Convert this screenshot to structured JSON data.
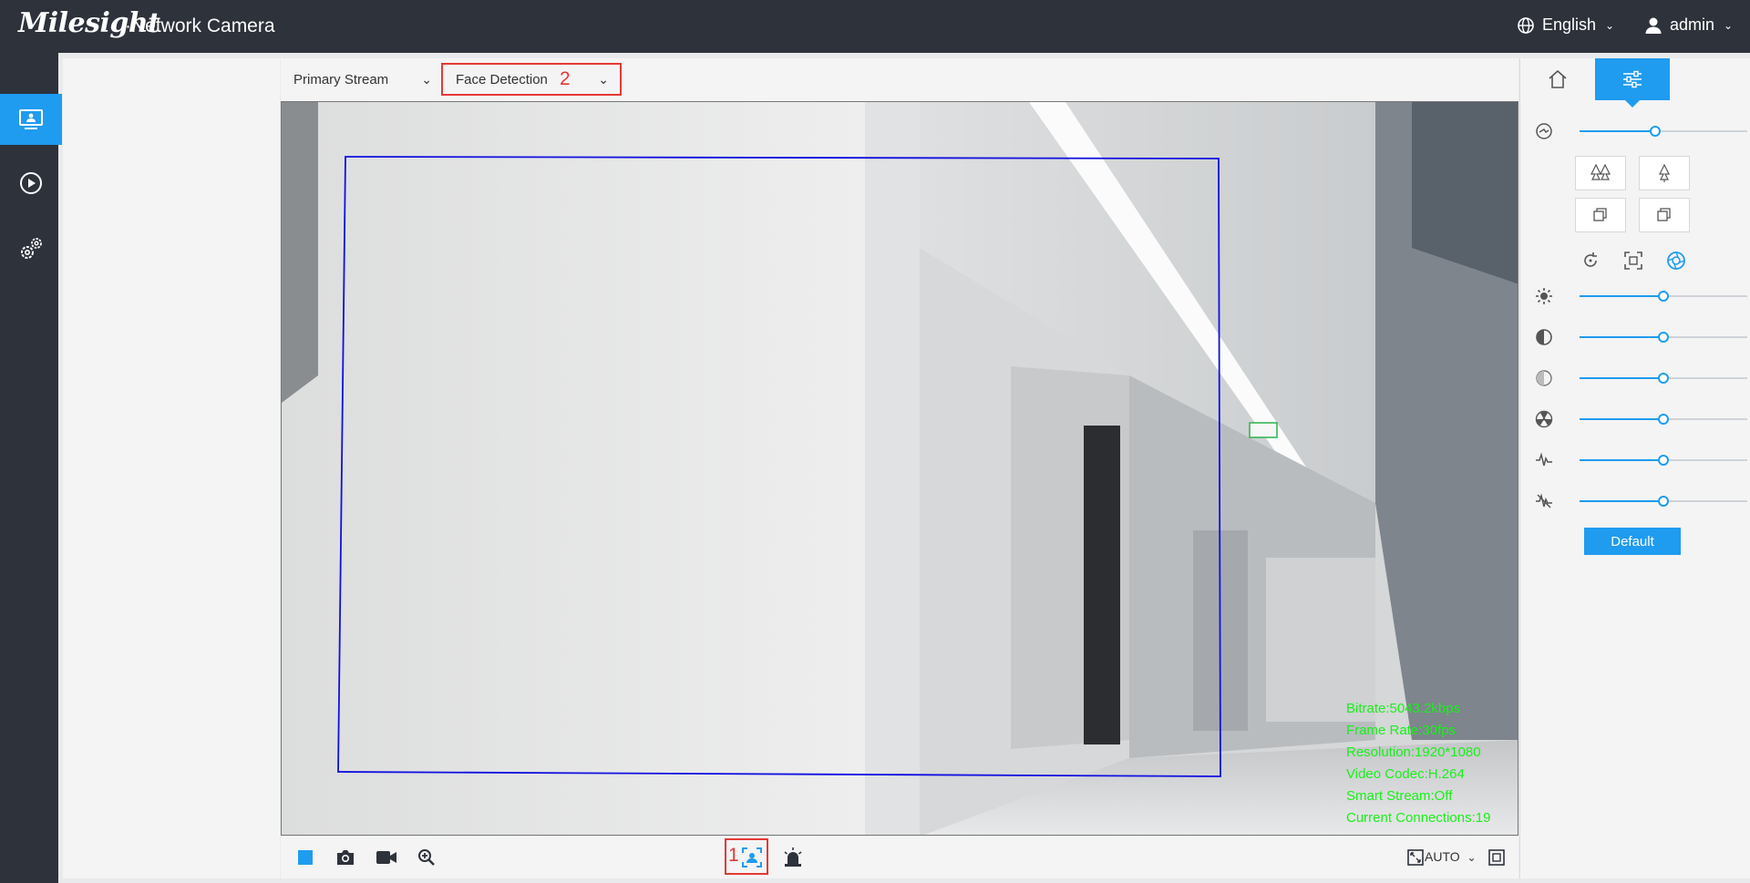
{
  "header": {
    "logo": "Milesight",
    "product": "·Network Camera",
    "language": "English",
    "user": "admin"
  },
  "left_nav": [
    "live-view-icon",
    "playback-icon",
    "settings-icon"
  ],
  "toolbar": {
    "stream": "Primary Stream",
    "mode": "Face Detection",
    "mode_marker": "2"
  },
  "video": {
    "stats": [
      "Bitrate:5043.2kbps",
      "Frame Rate:30fps",
      "Resolution:1920*1080",
      "Video Codec:H.264",
      "Smart Stream:Off",
      "Current Connections:19"
    ],
    "detection_box_color": "#1010e0",
    "stats_color": "#18f01a"
  },
  "bottombar": {
    "buttons": [
      "stop-icon",
      "snapshot-icon",
      "record-icon",
      "zoom-icon",
      "smart-detection-icon",
      "alarm-icon"
    ],
    "smart_marker": "1",
    "aspect": "AUTO"
  },
  "right_panel": {
    "tabs": [
      "home-icon",
      "image-settings-icon"
    ],
    "ptz_speed": 0.45,
    "image_sliders": [
      {
        "name": "brightness-icon",
        "value": 0.5
      },
      {
        "name": "contrast-icon",
        "value": 0.5
      },
      {
        "name": "saturation-icon",
        "value": 0.5
      },
      {
        "name": "sharpness-icon",
        "value": 0.5
      },
      {
        "name": "noise-reduction-icon",
        "value": 0.5
      },
      {
        "name": "defog-icon",
        "value": 0.5
      }
    ],
    "default_label": "Default",
    "accent": "#1f9bf0"
  }
}
